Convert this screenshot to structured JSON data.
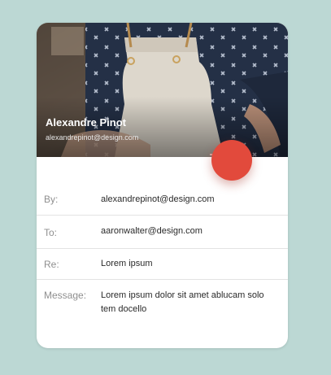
{
  "profile": {
    "name": "Alexandre Pinot",
    "email": "alexandrepinot@design.com"
  },
  "fab": {
    "icon": "red-circle-action",
    "color": "#e24a3c"
  },
  "form": {
    "by_label": "By:",
    "by_value": "alexandrepinot@design.com",
    "to_label": "To:",
    "to_value": "aaronwalter@design.com",
    "re_label": "Re:",
    "re_value": "Lorem ipsum",
    "message_label": "Message:",
    "message_value": "Lorem ipsum dolor sit amet ablucam solo tem docello"
  },
  "colors": {
    "background": "#bcd8d4",
    "card": "#ffffff",
    "accent": "#e24a3c"
  }
}
